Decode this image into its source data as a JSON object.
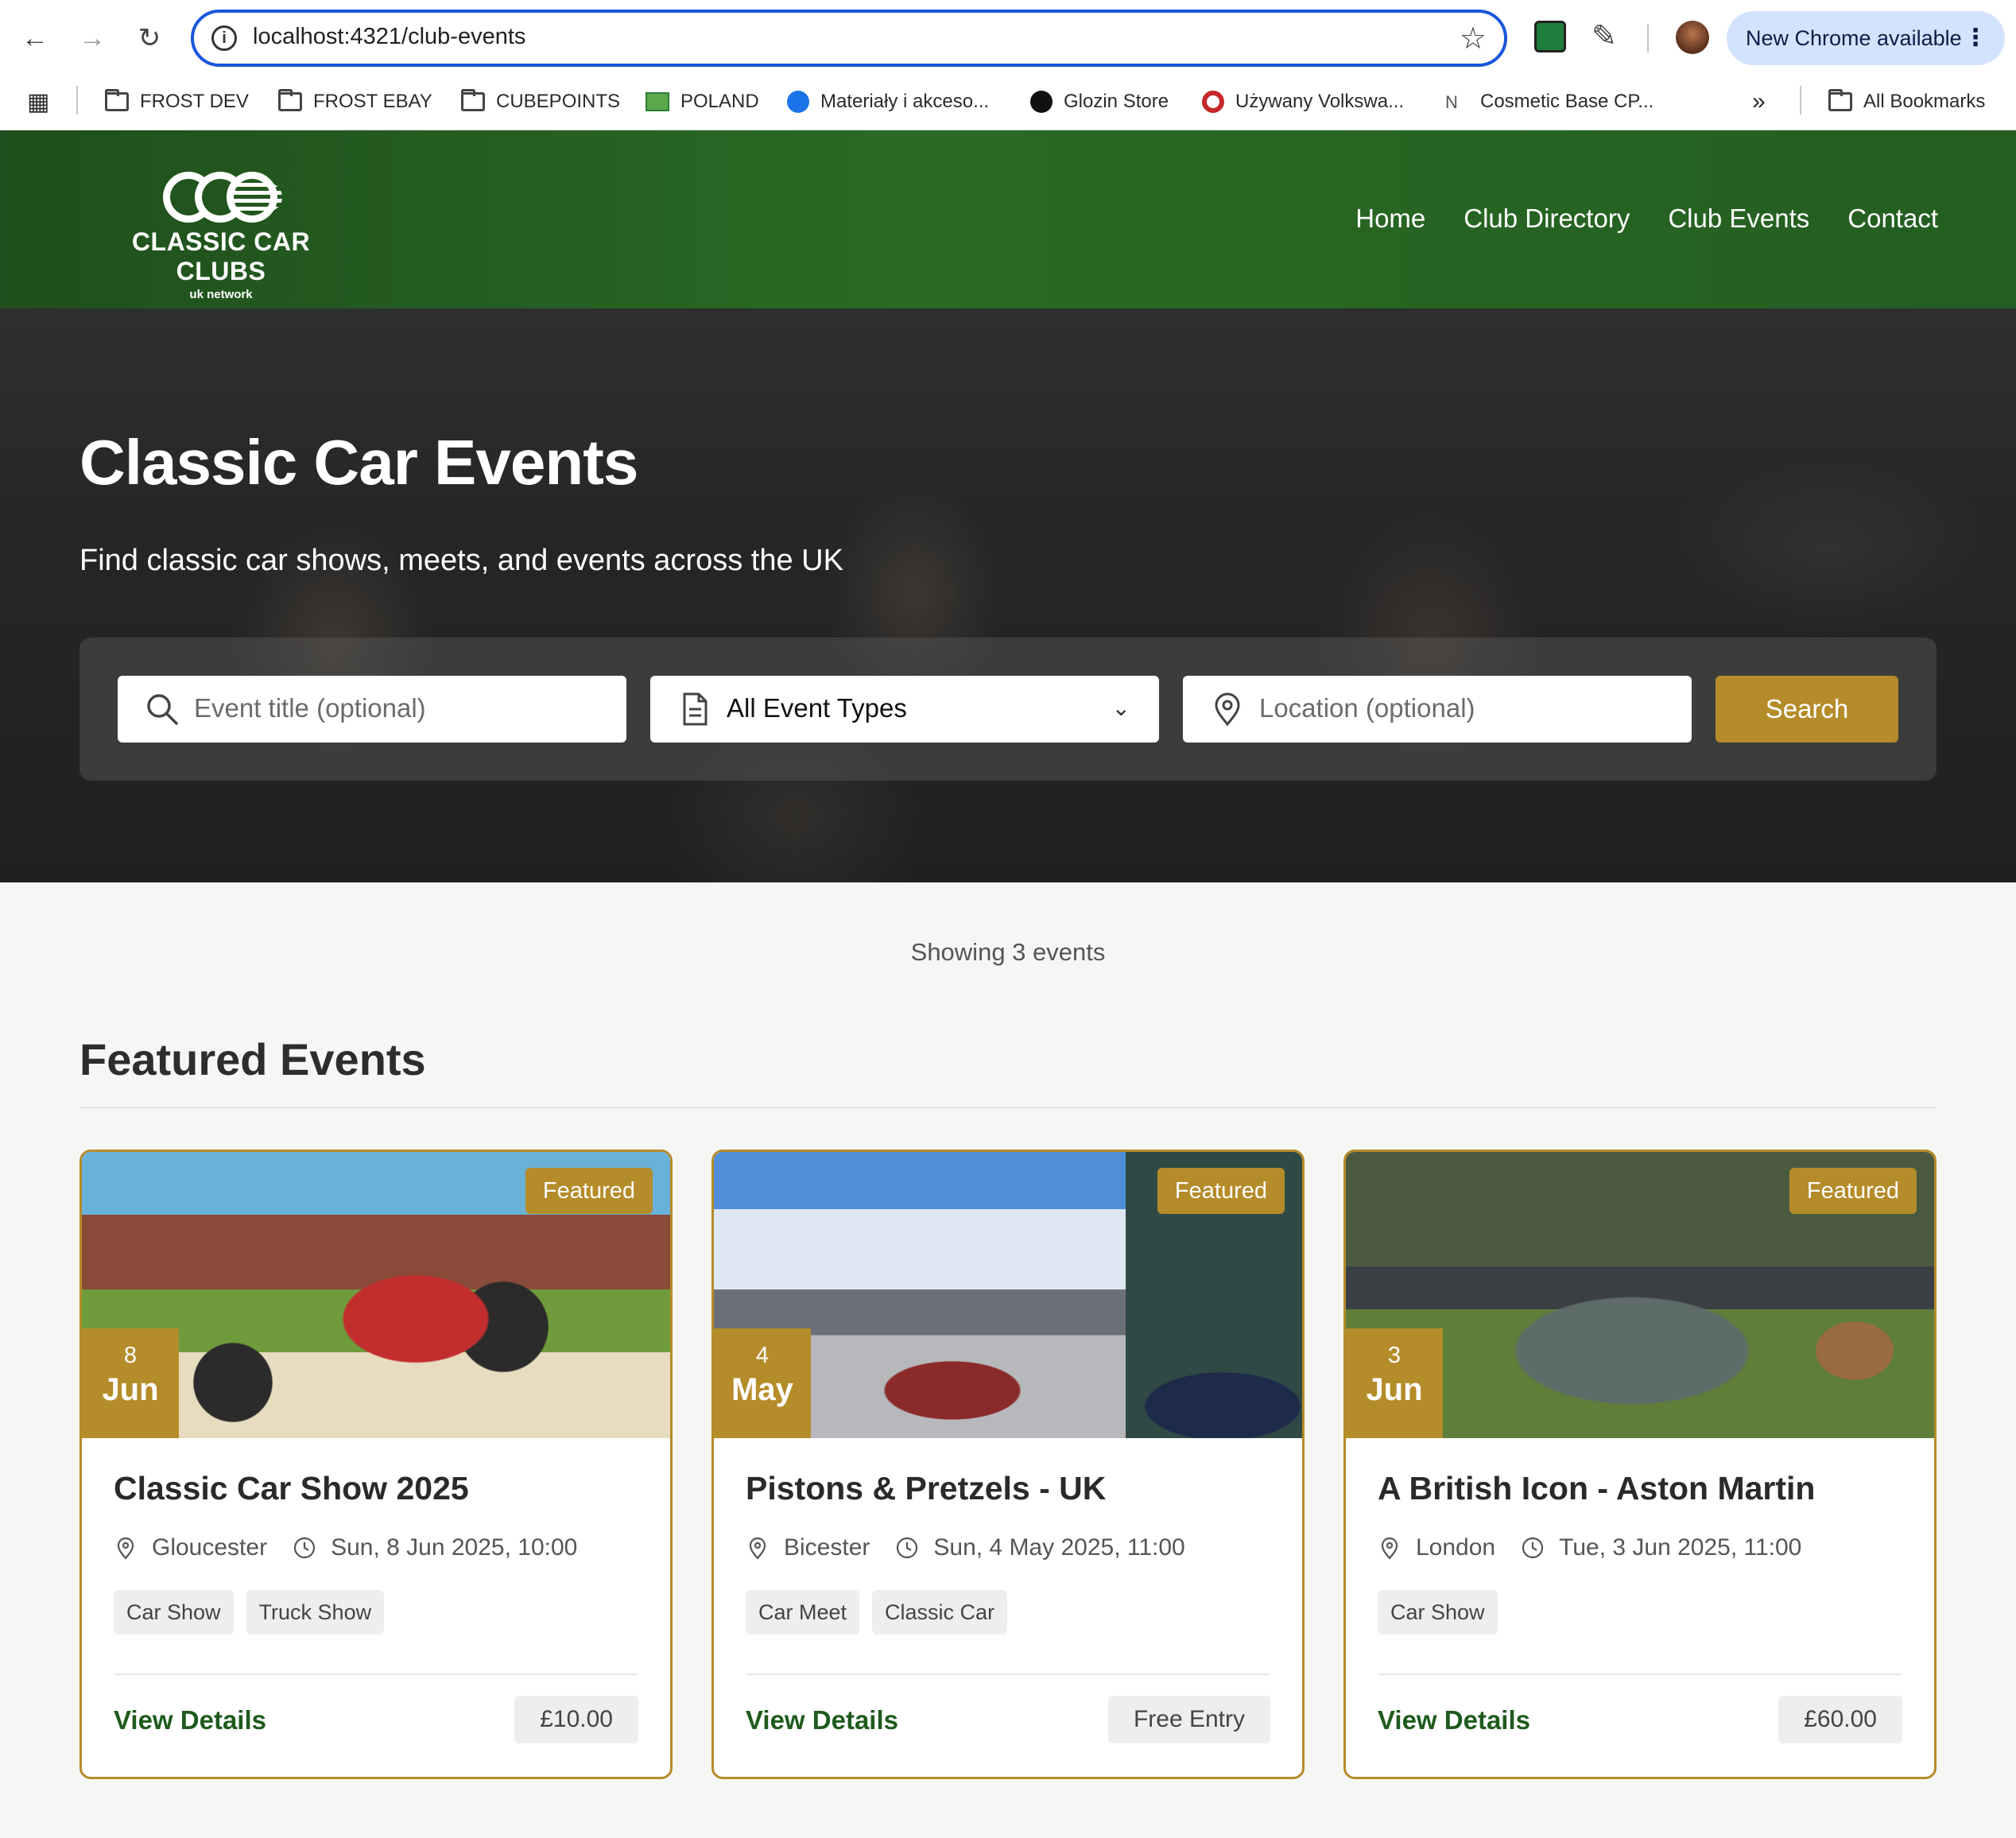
{
  "browser": {
    "url": "localhost:4321/club-events",
    "update_label": "New Chrome available",
    "bookmarks": [
      "FROST DEV",
      "FROST EBAY",
      "CUBEPOINTS",
      "POLAND",
      "Materiały i akceso...",
      "Glozin Store",
      "Używany Volkswa...",
      "Cosmetic Base CP..."
    ],
    "all_bookmarks": "All Bookmarks"
  },
  "site": {
    "logo_title": "CLASSIC CAR CLUBS",
    "logo_sub": "uk network",
    "nav": [
      "Home",
      "Club Directory",
      "Club Events",
      "Contact"
    ]
  },
  "hero": {
    "title": "Classic Car Events",
    "lead": "Find classic car shows, meets, and events across the UK",
    "search": {
      "title_placeholder": "Event title (optional)",
      "type_selected": "All Event Types",
      "location_placeholder": "Location (optional)",
      "button": "Search"
    }
  },
  "results": {
    "count_text": "Showing 3 events",
    "section_title": "Featured Events"
  },
  "events": [
    {
      "badge": "Featured",
      "day": "8",
      "month": "Jun",
      "title": "Classic Car Show 2025",
      "location": "Gloucester",
      "datetime": "Sun, 8 Jun 2025, 10:00",
      "tags": [
        "Car Show",
        "Truck Show"
      ],
      "link": "View Details",
      "price": "£10.00"
    },
    {
      "badge": "Featured",
      "day": "4",
      "month": "May",
      "title": "Pistons & Pretzels - UK",
      "location": "Bicester",
      "datetime": "Sun, 4 May 2025, 11:00",
      "tags": [
        "Car Meet",
        "Classic Car"
      ],
      "link": "View Details",
      "price": "Free Entry"
    },
    {
      "badge": "Featured",
      "day": "3",
      "month": "Jun",
      "title": "A British Icon - Aston Martin",
      "location": "London",
      "datetime": "Tue, 3 Jun 2025, 11:00",
      "tags": [
        "Car Show"
      ],
      "link": "View Details",
      "price": "£60.00"
    }
  ],
  "colors": {
    "brand_green": "#2a6a25",
    "accent_gold": "#b58c2a",
    "link_green": "#1e5b1c"
  }
}
